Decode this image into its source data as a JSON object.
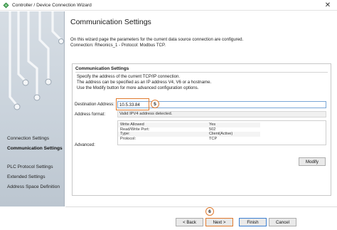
{
  "window": {
    "title": "Controller / Device Connection Wizard",
    "close_glyph": "✕"
  },
  "sidebar": {
    "items": [
      {
        "label": "Connection Settings"
      },
      {
        "label": "Communication Settings"
      },
      {
        "label": "PLC Protocol Settings"
      },
      {
        "label": "Extended Settings"
      },
      {
        "label": "Address Space Definition"
      }
    ],
    "active_index": 1
  },
  "header": {
    "title": "Communication Settings",
    "desc_line1": "On this wizard page the parameters for the current data source connection are configured.",
    "desc_line2": "Connection: Rheonics_1 - Protocol: Modbus TCP."
  },
  "panel": {
    "title": "Communication Settings",
    "desc_line1": "Specify the address of the current TCP/IP connection.",
    "desc_line2": "The address can be specified as an IP address V4, V6 or a  hostname.",
    "desc_line3": "Use the Modify button for more advanced configuration options.",
    "destination_label": "Destination Address:",
    "destination_value": "10.5.33.84",
    "format_label": "Address format:",
    "format_value": "Valid IPV4 address detected.",
    "advanced_label": "Advanced:",
    "advanced_rows": [
      {
        "key": "Write Allowed",
        "value": "Yes"
      },
      {
        "key": "Read/Write Port:",
        "value": "502"
      },
      {
        "key": "Type:",
        "value": "Client(Active)"
      },
      {
        "key": "Protocol:",
        "value": "TCP"
      }
    ],
    "modify_label": "Modify",
    "step_badge": "5"
  },
  "footer": {
    "back_label": "< Back",
    "next_label": "Next >",
    "finish_label": "Finish",
    "cancel_label": "Cancel",
    "step_badge": "6"
  },
  "colors": {
    "highlight": "#e07a2e",
    "focus_border": "#3c7fd1"
  }
}
